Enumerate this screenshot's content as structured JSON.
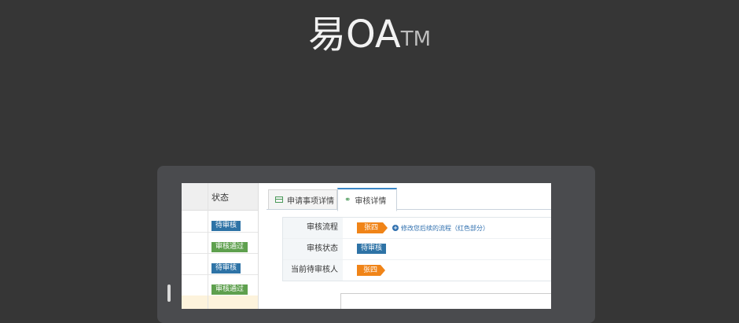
{
  "brand": {
    "name": "易OA",
    "mark": "TM"
  },
  "table": {
    "header": "状态",
    "rows": [
      {
        "status": "待审核",
        "color": "#2e73a6"
      },
      {
        "status": "审核通过",
        "color": "#5ea04e"
      },
      {
        "status": "待审核",
        "color": "#2e73a6"
      },
      {
        "status": "审核通过",
        "color": "#5ea04e"
      }
    ]
  },
  "tabs": [
    {
      "label": "申请事项详情",
      "icon": "table-icon"
    },
    {
      "label": "审核详情",
      "icon": "link-icon"
    }
  ],
  "detail": {
    "flow_label": "审核流程",
    "flow_person": "张四",
    "modify_link": "修改您后续的流程（红色部分）",
    "status_label": "审核状态",
    "status_value": "待审核",
    "current_label": "当前待审核人",
    "current_person": "张四"
  },
  "colors": {
    "accent": "#3b87c6",
    "orange": "#f08418",
    "blue": "#2e73a6",
    "green": "#5ea04e"
  }
}
